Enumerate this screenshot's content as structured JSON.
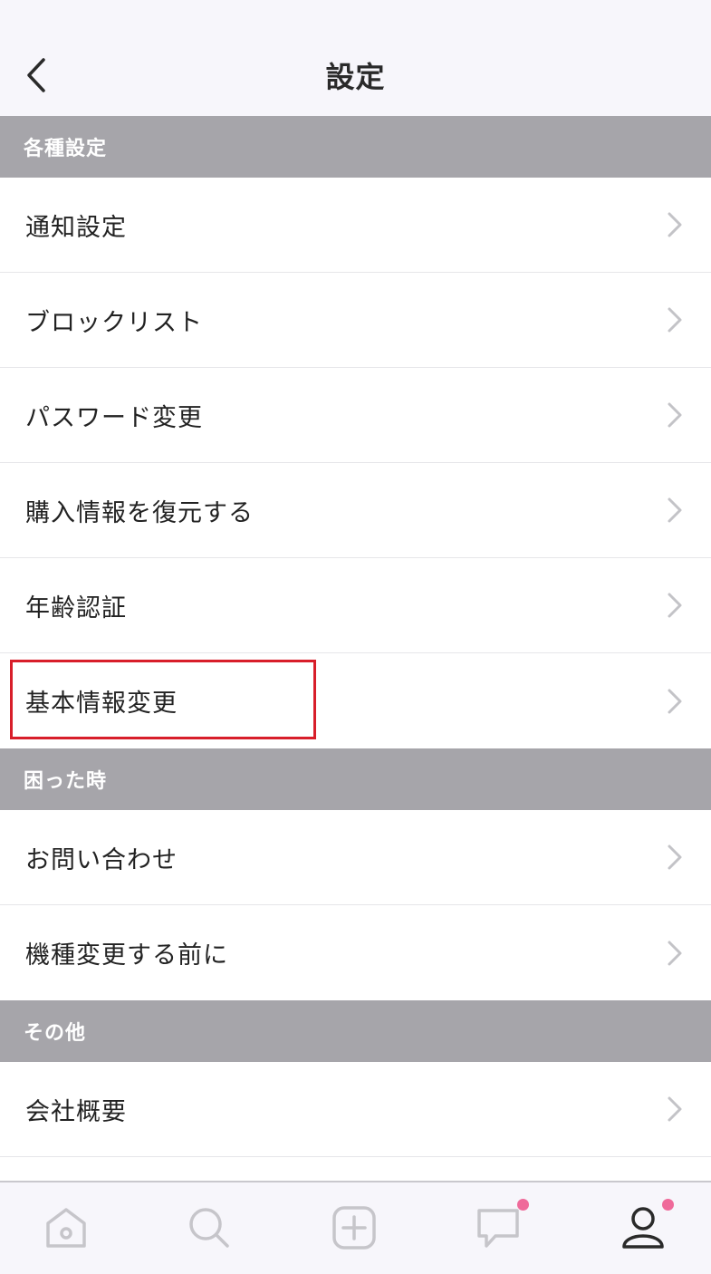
{
  "header": {
    "title": "設定"
  },
  "sections": [
    {
      "title": "各種設定",
      "items": [
        {
          "label": "通知設定"
        },
        {
          "label": "ブロックリスト"
        },
        {
          "label": "パスワード変更"
        },
        {
          "label": "購入情報を復元する"
        },
        {
          "label": "年齢認証"
        },
        {
          "label": "基本情報変更"
        }
      ]
    },
    {
      "title": "困った時",
      "items": [
        {
          "label": "お問い合わせ"
        },
        {
          "label": "機種変更する前に"
        }
      ]
    },
    {
      "title": "その他",
      "items": [
        {
          "label": "会社概要"
        }
      ]
    }
  ],
  "tab_bar": {
    "tabs": [
      {
        "icon": "home-icon",
        "active": false,
        "badge": false
      },
      {
        "icon": "search-icon",
        "active": false,
        "badge": false
      },
      {
        "icon": "add-icon",
        "active": false,
        "badge": false
      },
      {
        "icon": "chat-icon",
        "active": false,
        "badge": true
      },
      {
        "icon": "profile-icon",
        "active": true,
        "badge": true
      }
    ]
  },
  "colors": {
    "section_header_bg": "#a6a5aa",
    "highlight": "#d81e2a",
    "badge": "#ef6a9a",
    "inactive_icon": "#c6c5ca",
    "active_icon": "#2a2a2a"
  }
}
